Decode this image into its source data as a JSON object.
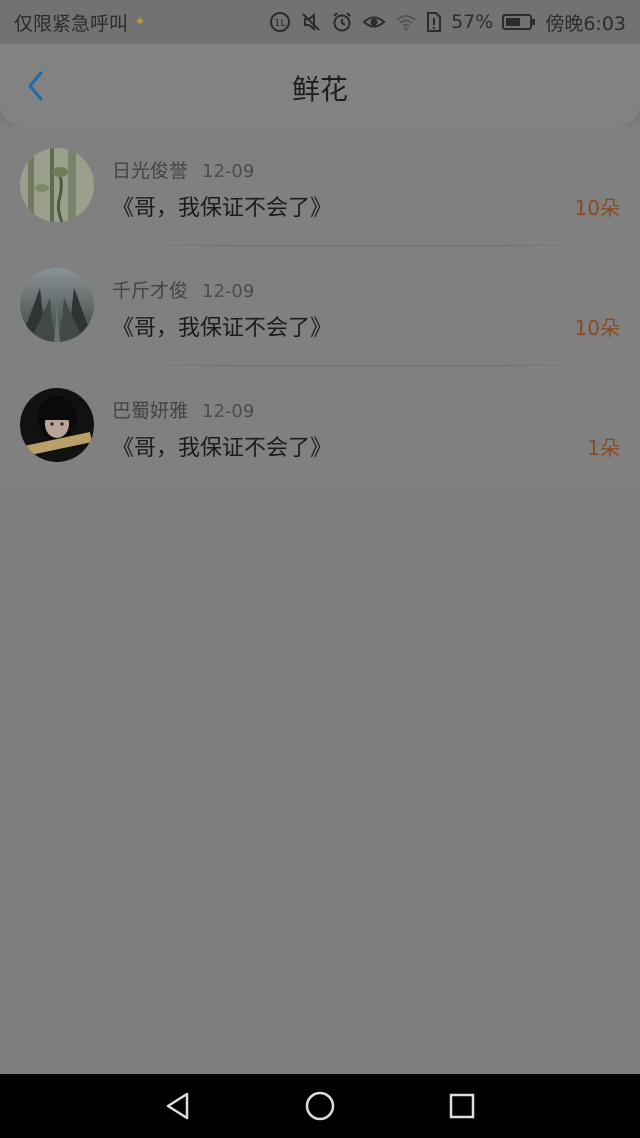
{
  "status_bar": {
    "carrier_text": "仅限紧急呼叫",
    "sparkle_icon": "sparkle-icon",
    "battery_percent": "57%",
    "time": "傍晚6:03",
    "icons": [
      "hd-icon",
      "mute-icon",
      "alarm-icon",
      "eye-icon",
      "wifi-icon",
      "sim-alert-icon",
      "battery-icon"
    ]
  },
  "nav": {
    "title": "鲜花",
    "back_icon": "chevron-left-icon",
    "accent_color": "#1c6aa8"
  },
  "list": [
    {
      "name": "日光俊誉",
      "date": "12-09",
      "book": "《哥，我保证不会了》",
      "count": "10朵",
      "avatar": "nature-avatar"
    },
    {
      "name": "千斤才俊",
      "date": "12-09",
      "book": "《哥，我保证不会了》",
      "count": "10朵",
      "avatar": "foggy-forest-avatar"
    },
    {
      "name": "巴蜀妍雅",
      "date": "12-09",
      "book": "《哥，我保证不会了》",
      "count": "1朵",
      "avatar": "girl-avatar"
    }
  ],
  "colors": {
    "count_color": "#8a4a22",
    "overlay_background": "#7d7d7d"
  },
  "system_nav": {
    "icons": [
      "back-triangle-icon",
      "home-circle-icon",
      "recents-square-icon"
    ]
  }
}
